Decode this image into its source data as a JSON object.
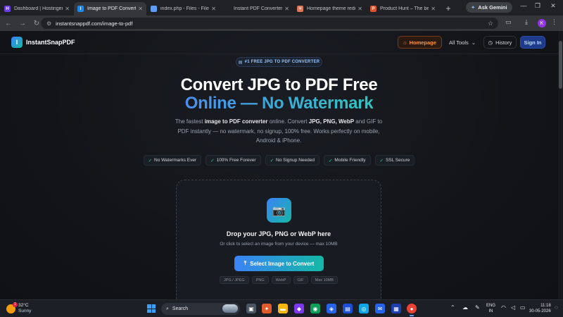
{
  "browser": {
    "tabs": [
      {
        "title": "Dashboard | Hostinger",
        "fav_color": "#673de6",
        "fav_char": "H",
        "active": false
      },
      {
        "title": "Image to PDF Converter",
        "fav_color": "#1e88e5",
        "fav_char": "I",
        "active": true
      },
      {
        "title": "index.php - Files - File",
        "fav_color": "#5f9cf4",
        "fav_char": "",
        "active": false
      },
      {
        "title": "Instant PDF Converter",
        "fav_color": "#202124",
        "fav_char": "",
        "active": false
      },
      {
        "title": "Homepage theme redes",
        "fav_color": "#d97757",
        "fav_char": "✳",
        "active": false
      },
      {
        "title": "Product Hunt – The bes",
        "fav_color": "#da552f",
        "fav_char": "P",
        "active": false
      }
    ],
    "new_tab": "+",
    "ask_gemini": "Ask Gemini",
    "url": "instantsnappdf.com/image-to-pdf",
    "profile_initial": "K"
  },
  "site": {
    "logo_text": "InstantSnapPDF",
    "nav": {
      "homepage": "Homepage",
      "all_tools": "All Tools",
      "history": "History",
      "sign_in": "Sign In"
    },
    "badge": "#1 FREE JPG TO PDF CONVERTER",
    "headline_line1": "Convert JPG to PDF Free",
    "headline_line2": "Online — No Watermark",
    "subtitle": {
      "p1": "The fastest ",
      "b1": "image to PDF converter",
      "p2": " online. Convert ",
      "b2": "JPG, PNG, WebP",
      "p3": " and GIF to PDF instantly — no watermark, no signup, 100% free. Works perfectly on mobile, Android & iPhone."
    },
    "features": [
      "No Watermarks Ever",
      "100% Free Forever",
      "No Signup Needed",
      "Mobile Friendly",
      "SSL Secure"
    ],
    "dropzone": {
      "title": "Drop your JPG, PNG or WebP here",
      "subtitle": "Or click to select an image from your device — max 10MB",
      "button": "Select Image to Convert",
      "formats": [
        "JPG / JPEG",
        "PNG",
        "WebP",
        "GIF",
        "Max 10MB"
      ]
    }
  },
  "taskbar": {
    "temperature": "32°C",
    "condition": "Sunny",
    "weather_alert": "1",
    "search_label": "Search",
    "lang_top": "ENG",
    "lang_bottom": "IN",
    "time": "11:18",
    "date": "30-05-2026"
  },
  "colors": {
    "accent_blue": "#3b82f6",
    "accent_teal": "#14b8a6",
    "home_orange": "#fb923c",
    "check_green": "#34d399"
  }
}
